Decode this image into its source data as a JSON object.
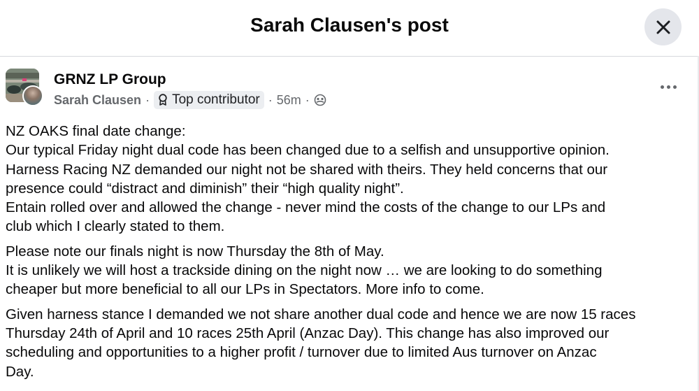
{
  "header": {
    "title": "Sarah Clausen's post",
    "close_icon": "close-icon"
  },
  "post": {
    "group_name": "GRNZ LP Group",
    "author": "Sarah Clausen",
    "badge": {
      "icon": "contributor-badge-icon",
      "label": "Top contributor"
    },
    "time": "56m",
    "audience_icon": "group-audience-icon",
    "more_icon": "more-options-icon",
    "paragraphs": [
      {
        "lines": [
          "NZ OAKS final date change:",
          "Our typical Friday night dual code has been changed due to a selfish and unsupportive opinion.",
          "Harness Racing NZ demanded our night not be shared with theirs. They held concerns that our",
          "presence could “distract and diminish” their “high quality night”.",
          "Entain rolled over and allowed the change - never mind the costs of the change to our LPs and",
          "club which I clearly stated to them."
        ]
      },
      {
        "lines": [
          "Please note our finals night is now Thursday the 8th of May.",
          "It is unlikely we will host a trackside dining on the night now … we are looking to do something",
          "cheaper but more beneficial to all our LPs in Spectators. More info to come."
        ]
      },
      {
        "lines": [
          "Given harness stance I demanded we not share another dual code and hence we are now 15 races",
          "Thursday 24th of April and 10 races 25th April (Anzac Day). This change has also improved our",
          "scheduling and opportunities to a higher profit / turnover due to limited Aus turnover on Anzac",
          "Day."
        ]
      }
    ]
  }
}
